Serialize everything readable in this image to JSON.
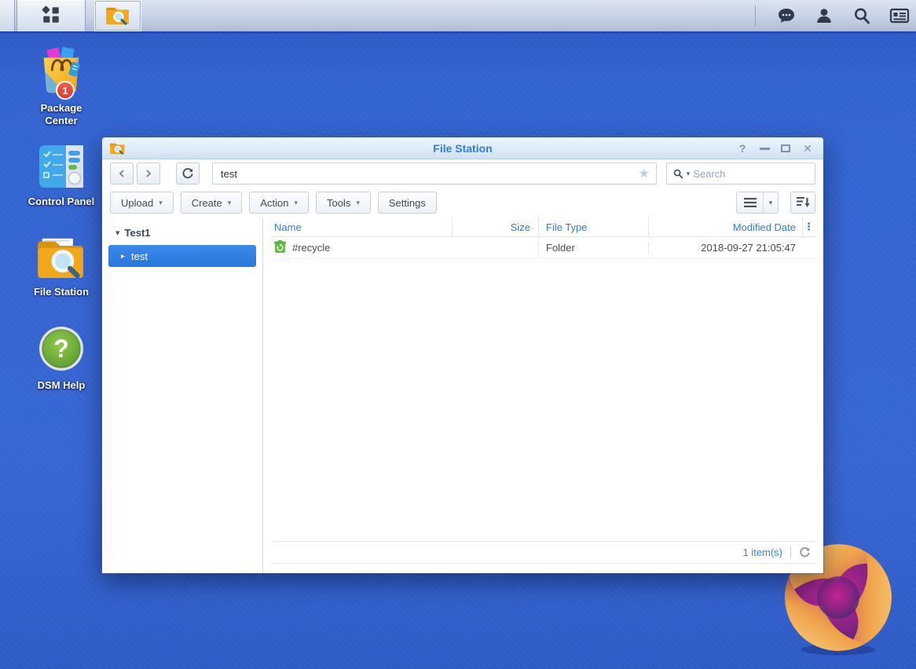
{
  "colors": {
    "desktop_blue": "#3363d0",
    "accent_blue": "#2f7fd9",
    "selection_blue": "#2e7fe0",
    "header_text_blue": "#2e7fd6",
    "badge_red": "#dd3b33",
    "folder_orange": "#f2a81d",
    "recycle_green": "#67bd4a"
  },
  "icons": {
    "star": "★",
    "caret_down": "▾",
    "tree_expanded": "▾",
    "tree_collapsed": "▸",
    "column_menu": "⋮",
    "help_glyph": "?",
    "close_glyph": "✕"
  },
  "taskbar": {
    "left_icons": [
      "main-menu-icon",
      "file-station-icon"
    ],
    "tray_icons": [
      "chat-icon",
      "user-icon",
      "search-icon",
      "resource-monitor-icon"
    ]
  },
  "desktop_icons": [
    {
      "label": "Package Center",
      "badge": "1",
      "icon": "package-center-icon"
    },
    {
      "label": "Control Panel",
      "icon": "control-panel-icon"
    },
    {
      "label": "File Station",
      "icon": "file-station-icon"
    },
    {
      "label": "DSM Help",
      "icon": "dsm-help-icon"
    }
  ],
  "window": {
    "title": "File Station",
    "address": {
      "value": "test"
    },
    "search": {
      "placeholder": "Search"
    },
    "toolbar_buttons": [
      {
        "label": "Upload",
        "has_menu": true
      },
      {
        "label": "Create",
        "has_menu": true
      },
      {
        "label": "Action",
        "has_menu": true
      },
      {
        "label": "Tools",
        "has_menu": true
      },
      {
        "label": "Settings",
        "has_menu": false
      }
    ],
    "sidebar": {
      "root_label": "Test1",
      "items": [
        {
          "label": "test",
          "selected": true
        }
      ]
    },
    "file_list": {
      "columns": [
        "Name",
        "Size",
        "File Type",
        "Modified Date"
      ],
      "rows": [
        {
          "name": "#recycle",
          "size": "",
          "file_type": "Folder",
          "modified_date": "2018-09-27 21:05:47",
          "icon": "recycle-folder-icon"
        }
      ]
    },
    "status_bar": {
      "item_count": "1 item(s)"
    }
  }
}
